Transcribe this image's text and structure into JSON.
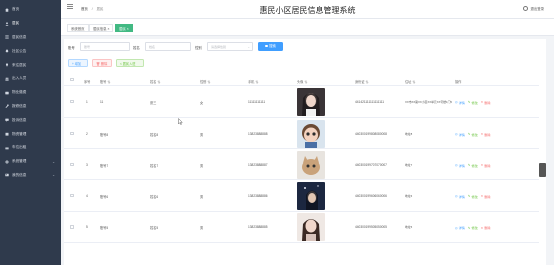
{
  "app": {
    "title": "惠民小区居民信息管理系统"
  },
  "topbar": {
    "crumb_home": "首页",
    "crumb_current": "居民",
    "logout": "退出登录"
  },
  "sidebar": {
    "items": [
      {
        "label": "首页",
        "icon": "home-icon"
      },
      {
        "label": "居民",
        "icon": "user-icon"
      },
      {
        "label": "居民信息",
        "icon": "list-icon"
      },
      {
        "label": "社区公告",
        "icon": "bell-icon"
      },
      {
        "label": "来往居民",
        "icon": "pin-icon"
      },
      {
        "label": "出入人员",
        "icon": "people-icon"
      },
      {
        "label": "物业缴费",
        "icon": "wallet-icon"
      },
      {
        "label": "报修信息",
        "icon": "wrench-icon"
      },
      {
        "label": "投诉信息",
        "icon": "message-icon"
      },
      {
        "label": "物资管理",
        "icon": "box-icon"
      },
      {
        "label": "车位出租",
        "icon": "car-icon"
      },
      {
        "label": "系统管理",
        "icon": "gear-icon",
        "arrow": "⌄"
      },
      {
        "label": "我的信息",
        "icon": "id-icon",
        "arrow": "⌄"
      }
    ]
  },
  "tabs": [
    {
      "label": "系统首页"
    },
    {
      "label": "居民信息 ×"
    },
    {
      "label": "居民 ×"
    }
  ],
  "search": {
    "fields": [
      {
        "label": "账号",
        "placeholder": "账号"
      },
      {
        "label": "姓名",
        "placeholder": "姓名"
      },
      {
        "label": "性别",
        "placeholder": "请选择性别"
      }
    ],
    "button": "搜索"
  },
  "actions": {
    "add": "+ 增加",
    "delete": "🗑 删除",
    "import": "< 居民入驻"
  },
  "table": {
    "headers": [
      "序号",
      "账号",
      "姓名",
      "性别",
      "手机",
      "头像",
      "身份证",
      "住址",
      "操作"
    ],
    "rows": [
      {
        "no": "1",
        "account": "11",
        "name": "张三",
        "gender": "女",
        "phone": "11111111111",
        "idcard": "441421111111111111",
        "address": "XX市XX路XX小区XX单元XX号楼1门5",
        "avatar": "girl-dark"
      },
      {
        "no": "2",
        "account": "账号8",
        "name": "姓名8",
        "gender": "男",
        "phone": "13823888888",
        "idcard": "440300199808080008",
        "address": "地址8",
        "avatar": "cartoon"
      },
      {
        "no": "3",
        "account": "账号7",
        "name": "姓名7",
        "gender": "男",
        "phone": "13823888887",
        "idcard": "440300199707070007",
        "address": "地址7",
        "avatar": "kitten"
      },
      {
        "no": "4",
        "account": "账号6",
        "name": "姓名6",
        "gender": "男",
        "phone": "13823888886",
        "idcard": "440300199606060006",
        "address": "地址6",
        "avatar": "night-girl"
      },
      {
        "no": "5",
        "account": "账号5",
        "name": "姓名5",
        "gender": "男",
        "phone": "13823888885",
        "idcard": "440300199505050005",
        "address": "地址5",
        "avatar": "girl-light"
      }
    ],
    "ops": {
      "view": "详情",
      "edit": "修改",
      "remove": "删除"
    }
  },
  "colors": {
    "sidebar": "#2f3a4c",
    "primary": "#409eff",
    "success": "#67c23a",
    "danger": "#f56c6c",
    "tab_active": "#42b983"
  }
}
